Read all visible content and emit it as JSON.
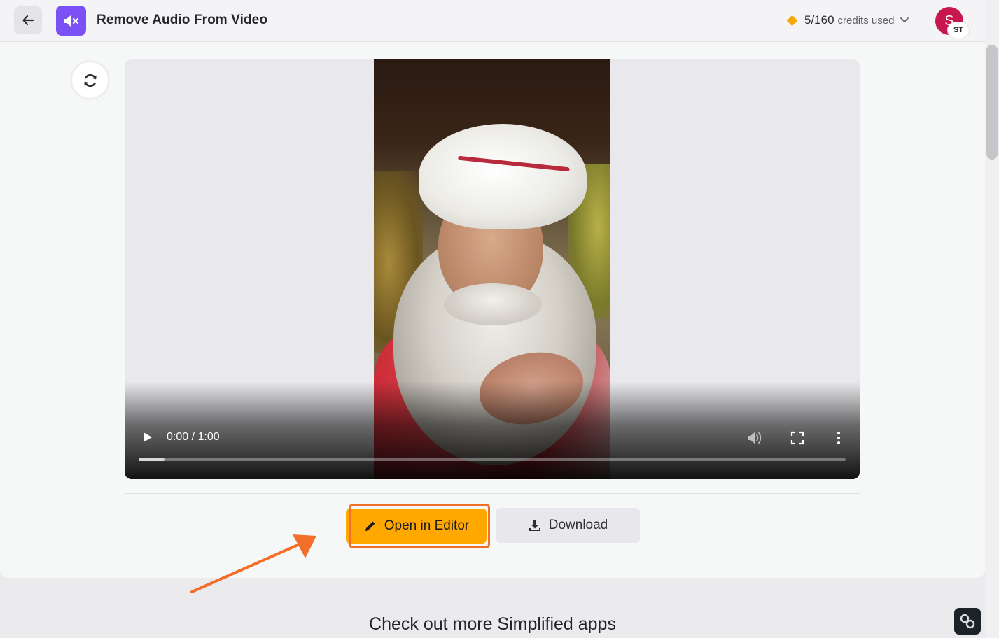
{
  "header": {
    "title": "Remove Audio From Video",
    "credits_count": "5/160",
    "credits_label": "credits used",
    "avatar_letter": "S",
    "avatar_badge": "ST"
  },
  "player": {
    "time": "0:00 / 1:00",
    "progress_fraction": 0.037
  },
  "actions": {
    "open_editor_label": "Open in Editor",
    "download_label": "Download"
  },
  "footer": {
    "more_apps_heading": "Check out more Simplified apps"
  },
  "colors": {
    "accent_purple": "#7b50f5",
    "primary_orange": "#ffa900",
    "annotation_orange": "#f26f2a",
    "avatar_bg": "#c8174f",
    "credits_diamond": "#f5a70a"
  },
  "icons": {
    "back": "arrow-left-icon",
    "app": "mute-speaker-icon",
    "refresh": "refresh-icon",
    "play": "play-icon",
    "volume": "volume-icon",
    "fullscreen": "fullscreen-icon",
    "more": "more-vertical-icon",
    "editor": "pencil-icon",
    "download": "download-icon",
    "dropdown": "chevron-down-icon",
    "widget": "link-icon"
  }
}
